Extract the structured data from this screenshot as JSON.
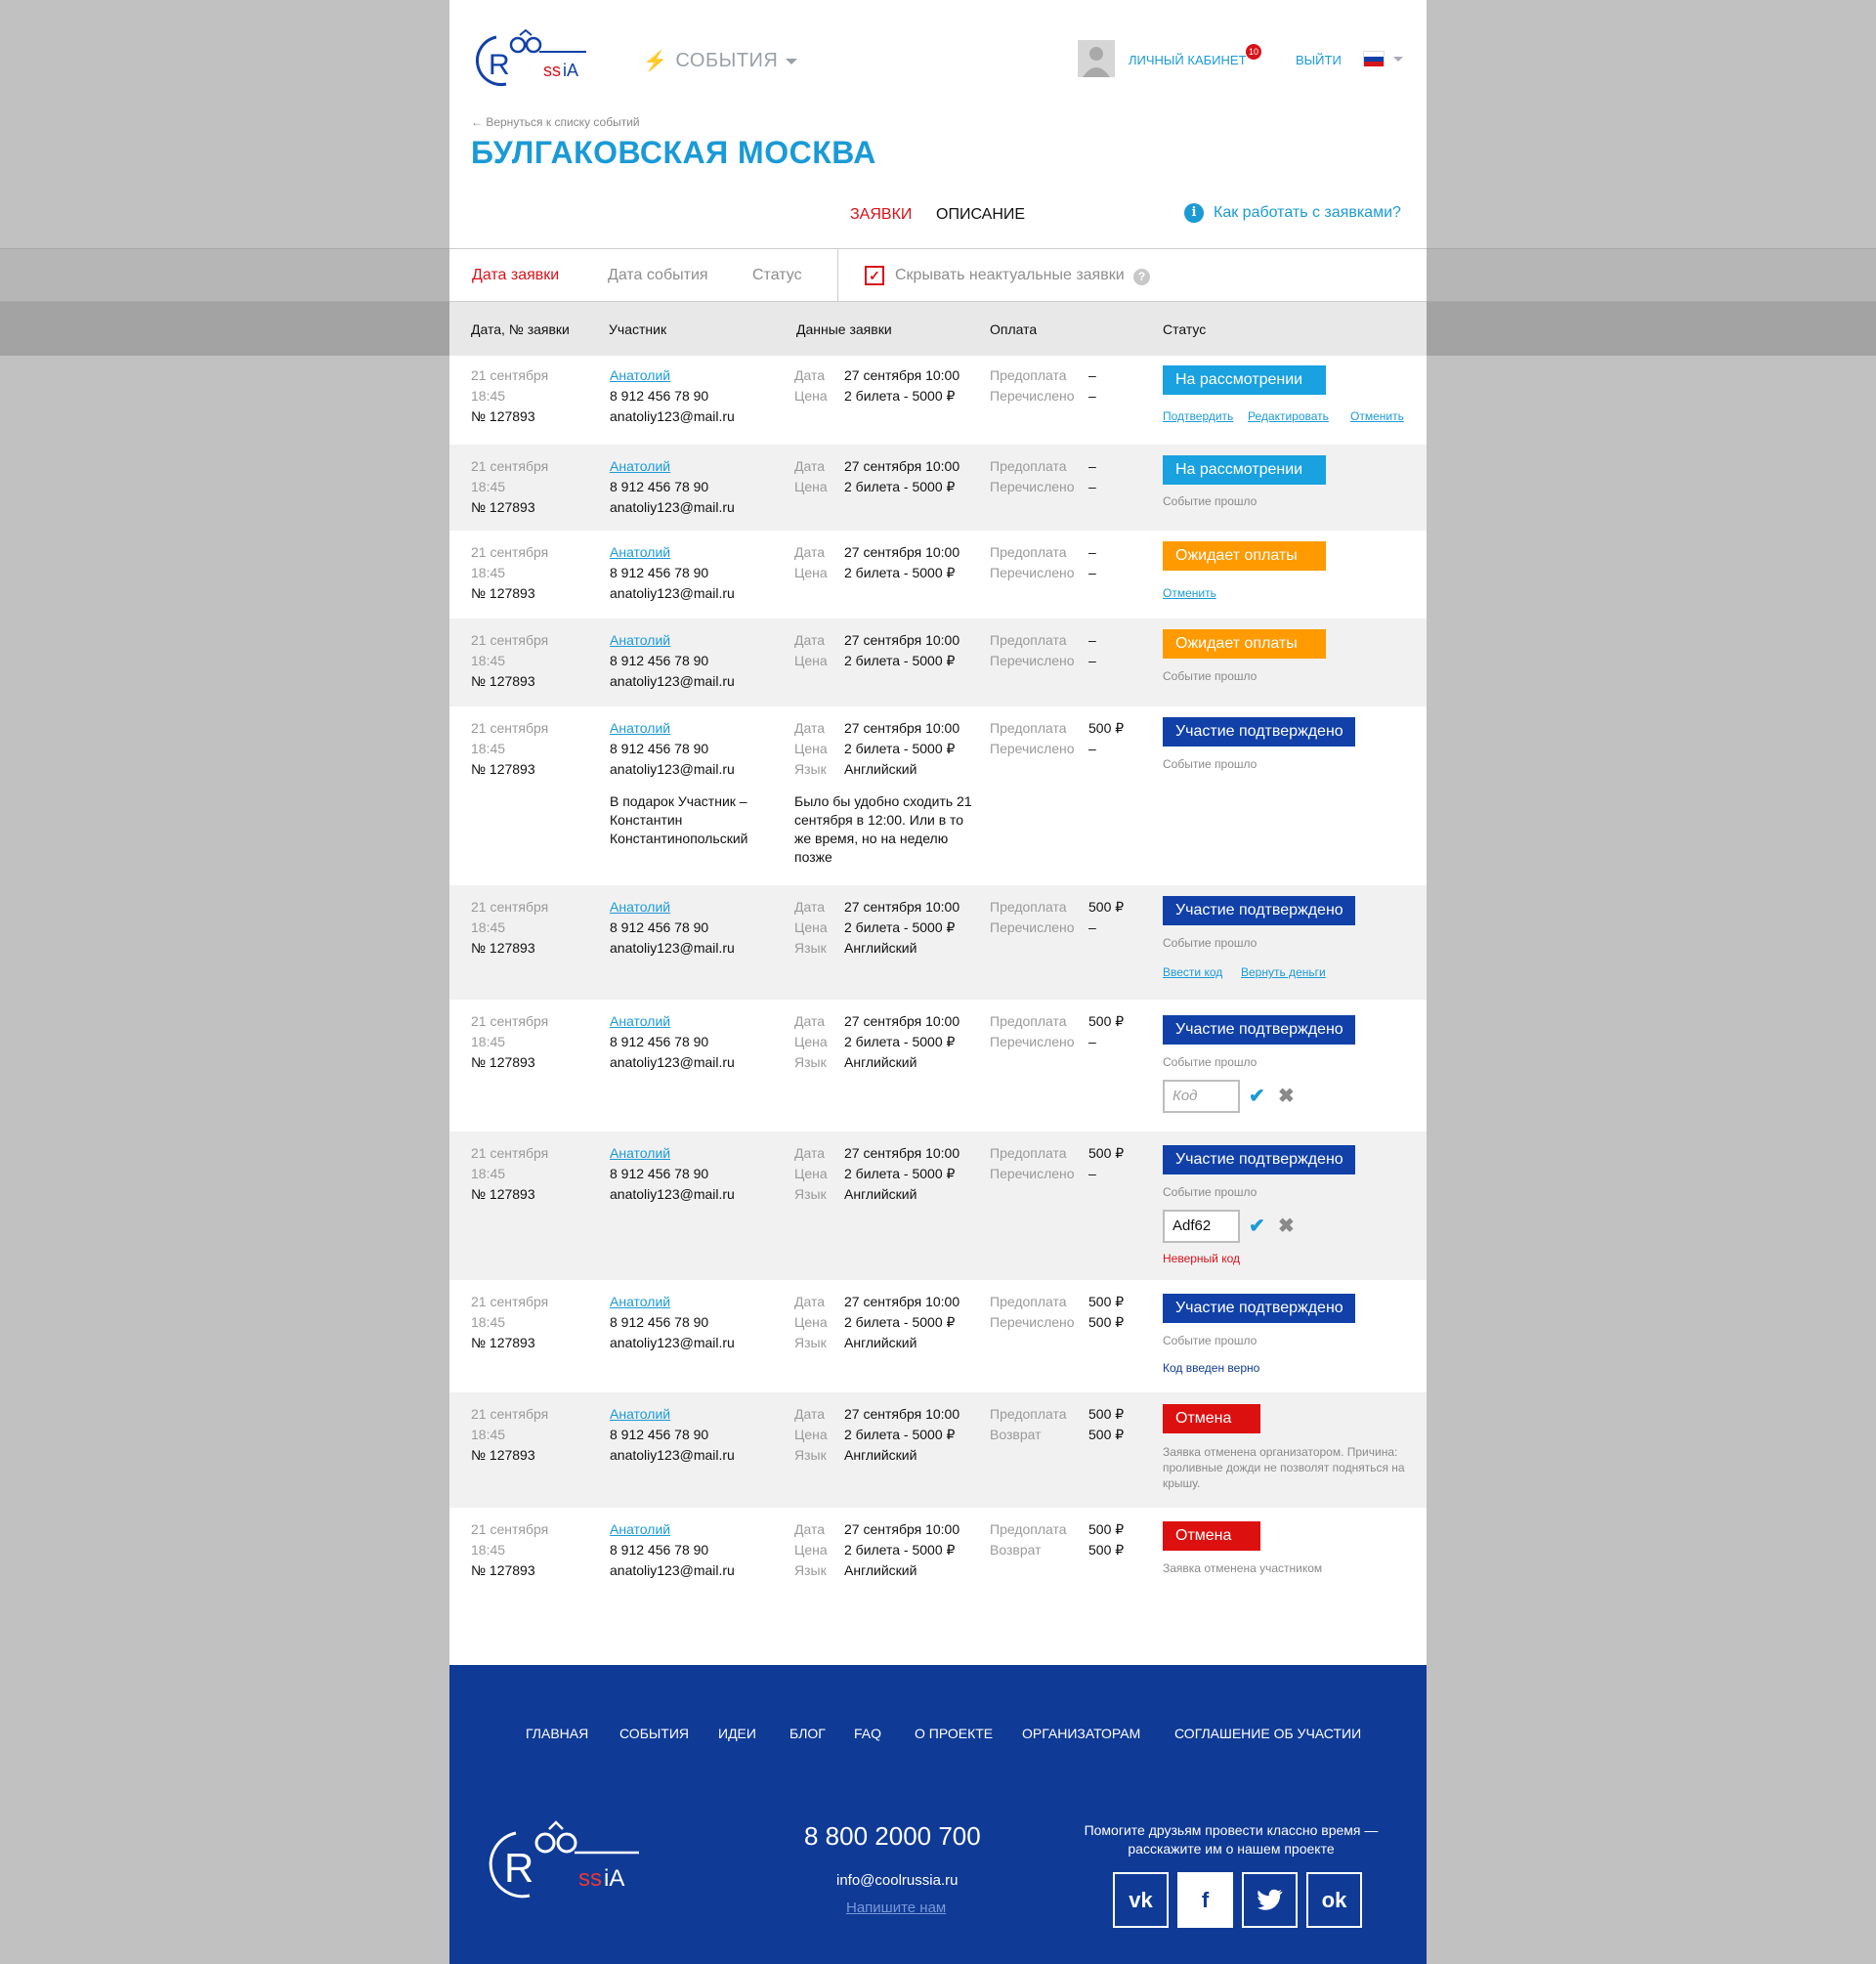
{
  "colors": {
    "accent": "#1b9ad6",
    "red": "#d8121a",
    "orange": "#ff9a00",
    "navy": "#1141a8",
    "footer": "#0f3a96"
  },
  "header": {
    "events_label": "СОБЫТИЯ",
    "cabinet_label": "ЛИЧНЫЙ КАБИНЕТ",
    "badge_count": "10",
    "logout_label": "ВЫЙТИ",
    "back_link": "← Вернуться к списку событий",
    "title": "БУЛГАКОВСКАЯ МОСКВА",
    "tabs": {
      "requests": "ЗАЯВКИ",
      "description": "ОПИСАНИЕ"
    },
    "help_link": "Как работать с заявками?"
  },
  "filters": {
    "date_request": "Дата заявки",
    "date_event": "Дата события",
    "status": "Статус",
    "hide_label": "Скрывать неактуальные заявки"
  },
  "columns": {
    "date": "Дата, № заявки",
    "participant": "Участник",
    "data": "Данные заявки",
    "payment": "Оплата",
    "status": "Статус"
  },
  "common": {
    "date": "21 сентября",
    "time": "18:45",
    "number": "№ 127893",
    "name": "Анатолий",
    "phone": "8 912 456 78 90",
    "email": "anatoliy123@mail.ru",
    "lab_date": "Дата",
    "lab_price": "Цена",
    "lab_lang": "Язык",
    "ev_date": "27 сентября 10:00",
    "price": "2 билета - 5000 ₽",
    "lang": "Английский",
    "lab_prepay": "Предоплата",
    "lab_transferred": "Перечислено",
    "lab_refund": "Возврат",
    "dash": "–",
    "amount": "500 ₽",
    "event_passed": "Событие прошло"
  },
  "statuses": {
    "review": "На рассмотрении",
    "await_pay": "Ожидает оплаты",
    "confirmed": "Участие подтверждено",
    "cancel": "Отмена"
  },
  "actions": {
    "confirm": "Подтвердить",
    "edit": "Редактировать",
    "cancel": "Отменить",
    "enter_code": "Ввести код",
    "refund": "Вернуть деньги"
  },
  "code": {
    "placeholder": "Код",
    "value": "Adf62",
    "error": "Неверный код",
    "ok": "Код введен верно"
  },
  "notes": {
    "gift": "В подарок Участник – Константин Константинопольский",
    "wish": "Было бы удобно сходить 21 сентября в 12:00. Или в то же время, но на неделю позже",
    "cancel_org": "Заявка отменена организатором. Причина: проливные дожди не позволят подняться на крышу.",
    "cancel_user": "Заявка отменена участником"
  },
  "footer": {
    "nav": [
      "ГЛАВНАЯ",
      "СОБЫТИЯ",
      "ИДЕИ",
      "БЛОГ",
      "FAQ",
      "О ПРОЕКТЕ",
      "ОРГАНИЗАТОРАМ",
      "СОГЛАШЕНИЕ ОБ УЧАСТИИ"
    ],
    "phone": "8 800 2000 700",
    "email": "info@coolrussia.ru",
    "write": "Напишите нам",
    "help": "Помогите друзьям провести классно время — расскажите им о нашем проекте",
    "social": [
      "vk-icon",
      "facebook-icon",
      "twitter-icon",
      "odnoklassniki-icon"
    ]
  }
}
